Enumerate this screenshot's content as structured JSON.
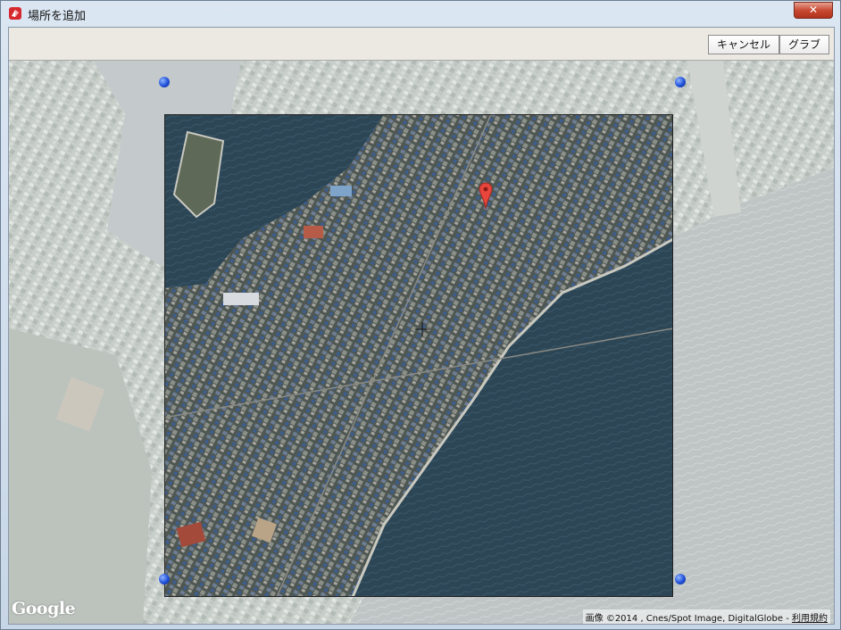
{
  "window": {
    "title": "場所を追加",
    "close_glyph": "✕"
  },
  "toolbar": {
    "cancel_label": "キャンセル",
    "grab_label": "グラブ"
  },
  "map": {
    "logo_text": "Google",
    "attribution_text": "画像 ©2014 , Cnes/Spot Image, DigitalGlobe -",
    "terms_link": "利用規約"
  },
  "icons": {
    "app": "sketchup-app-icon",
    "pin": "location-pin-icon",
    "crosshair": "crosshair-icon",
    "handle": "resize-handle-icon"
  },
  "colors": {
    "pin": "#e8453c",
    "handle": "#1f4fd8",
    "sea": "#2c4656",
    "close": "#c84a33"
  }
}
